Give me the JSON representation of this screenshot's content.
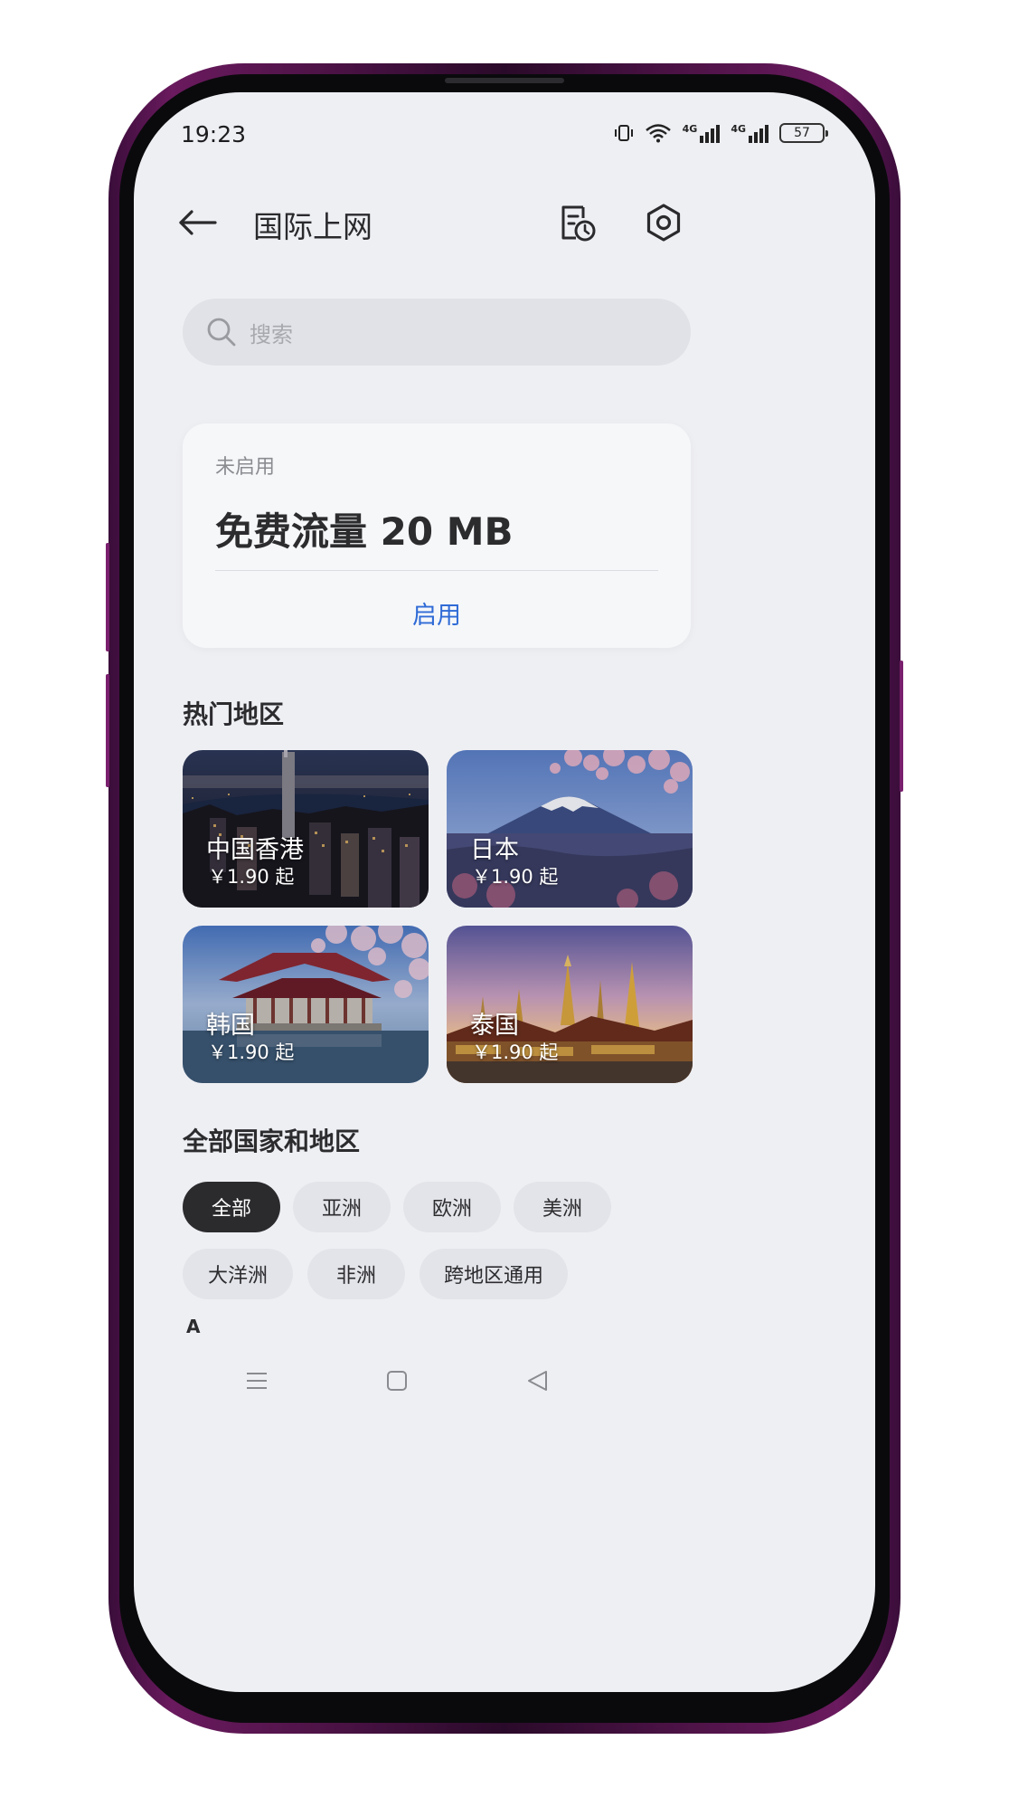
{
  "status_bar": {
    "time": "19:23",
    "icons": [
      "vibrate-icon",
      "wifi-icon",
      "signal-4g-icon",
      "signal-4g-icon"
    ],
    "signal_label": "4G",
    "battery": "57"
  },
  "header": {
    "title": "国际上网",
    "back_icon": "back-arrow-icon",
    "history_icon": "usage-history-icon",
    "settings_icon": "settings-icon"
  },
  "search": {
    "placeholder": "搜索",
    "icon": "search-icon"
  },
  "free_card": {
    "status": "未启用",
    "title": "免费流量 20 MB",
    "action": "启用",
    "action_color": "#2f6bd6"
  },
  "popular": {
    "title": "热门地区",
    "items": [
      {
        "name": "中国香港",
        "price": "￥1.90 起",
        "image": "hong-kong-night-skyline"
      },
      {
        "name": "日本",
        "price": "￥1.90 起",
        "image": "mount-fuji-cherry-blossom"
      },
      {
        "name": "韩国",
        "price": "￥1.90 起",
        "image": "korean-pavilion-cherry-blossom"
      },
      {
        "name": "泰国",
        "price": "￥1.90 起",
        "image": "thai-temple-sunset"
      }
    ]
  },
  "all_regions": {
    "title": "全部国家和地区",
    "filters": [
      "全部",
      "亚洲",
      "欧洲",
      "美洲",
      "大洋洲",
      "非洲",
      "跨地区通用"
    ],
    "selected": "全部"
  },
  "index_letter": "A",
  "nav_bar": {
    "icons": [
      "menu-icon",
      "home-icon",
      "back-icon"
    ]
  }
}
